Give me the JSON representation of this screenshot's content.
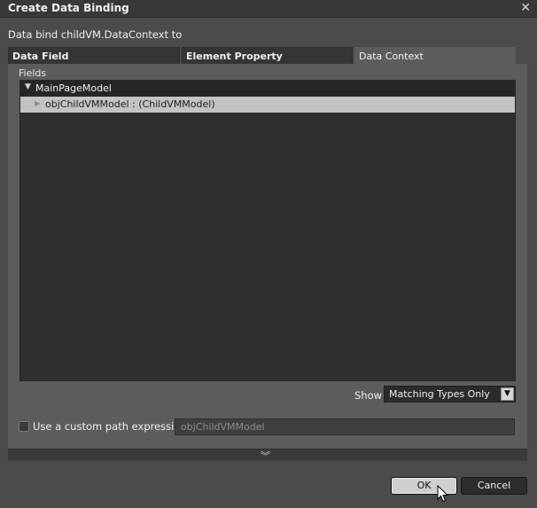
{
  "window": {
    "title": "Create Data Binding",
    "close_glyph": "✕"
  },
  "bind_label": "Data bind childVM.DataContext to",
  "tabs": [
    {
      "label": "Data Field",
      "active": false
    },
    {
      "label": "Element Property",
      "active": false
    },
    {
      "label": "Data Context",
      "active": true
    }
  ],
  "fields": {
    "label": "Fields",
    "tree": {
      "root": {
        "label": "MainPageModel",
        "expanded": true
      },
      "children": [
        {
          "label": "objChildVMModel : (ChildVMModel)",
          "selected": true
        }
      ]
    }
  },
  "show": {
    "label": "Show",
    "selected": "Matching Types Only"
  },
  "custom_path": {
    "label": "Use a custom path expression",
    "checked": false,
    "value": "objChildVMModel"
  },
  "buttons": {
    "ok": "OK",
    "cancel": "Cancel"
  },
  "colors": {
    "background": "#4b4b4b",
    "tree_background": "#2f2f2f",
    "selected_row": "#c3c3c3"
  }
}
